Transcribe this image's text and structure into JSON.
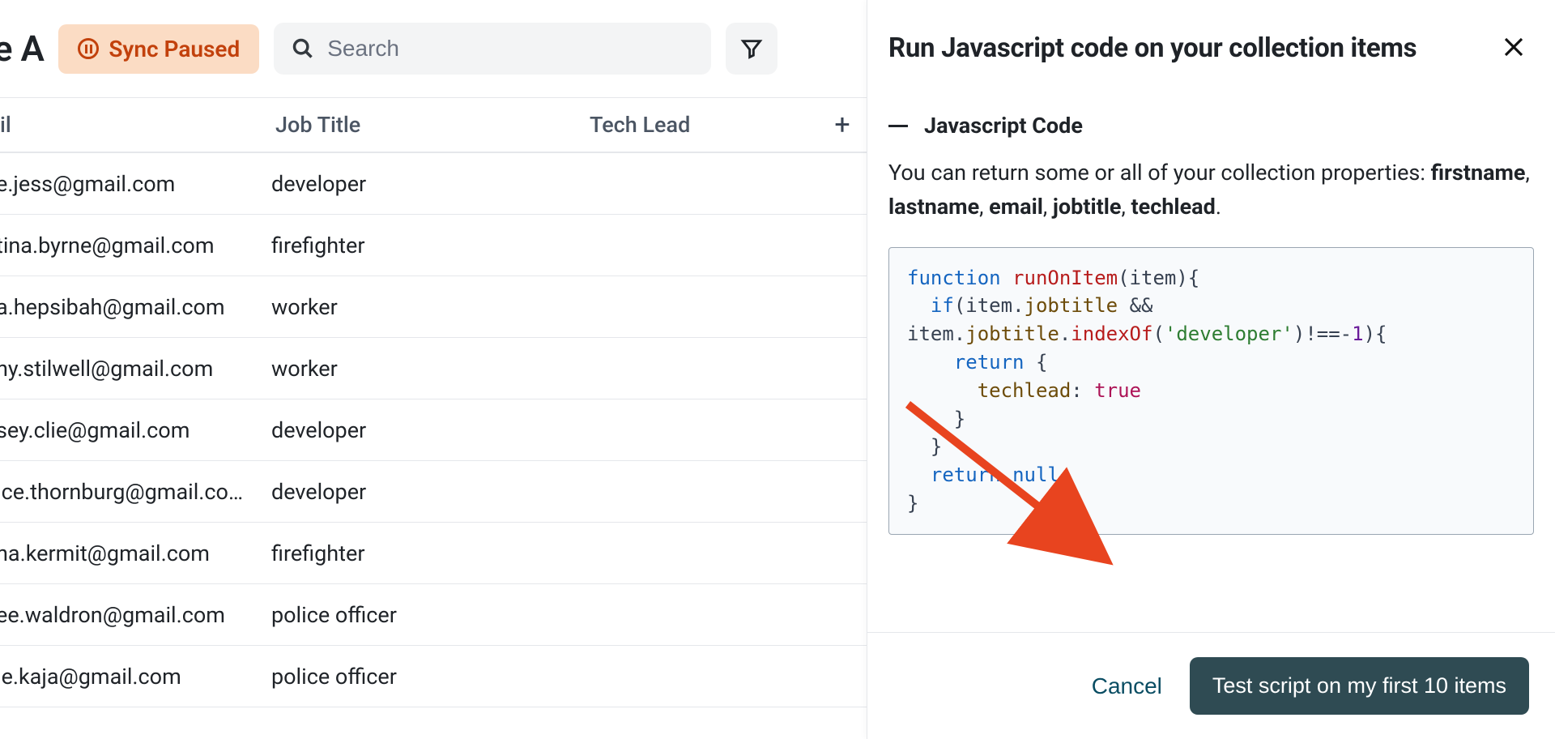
{
  "header": {
    "title_fragment": "ile A",
    "sync_status": "Sync Paused",
    "search_placeholder": "Search"
  },
  "table": {
    "columns": {
      "email": "il",
      "job": "Job Title",
      "tech": "Tech Lead"
    },
    "rows": [
      {
        "email": "e.jess@gmail.com",
        "job": "developer"
      },
      {
        "email": "tina.byrne@gmail.com",
        "job": "firefighter"
      },
      {
        "email": "a.hepsibah@gmail.com",
        "job": "worker"
      },
      {
        "email": "ny.stilwell@gmail.com",
        "job": "worker"
      },
      {
        "email": "sey.clie@gmail.com",
        "job": "developer"
      },
      {
        "email": "ice.thornburg@gmail.co…",
        "job": "developer"
      },
      {
        "email": "na.kermit@gmail.com",
        "job": "firefighter"
      },
      {
        "email": "ee.waldron@gmail.com",
        "job": "police officer"
      },
      {
        "email": "ie.kaja@gmail.com",
        "job": "police officer"
      }
    ]
  },
  "panel": {
    "title": "Run Javascript code on your collection items",
    "section_title": "Javascript Code",
    "desc_prefix": "You can return some or all of your collection properties: ",
    "properties": [
      "firstname",
      "lastname",
      "email",
      "jobtitle",
      "techlead"
    ],
    "code_tokens": [
      [
        [
          "kw",
          "function"
        ],
        [
          "sp",
          " "
        ],
        [
          "fn",
          "runOnItem"
        ],
        [
          "op",
          "("
        ],
        [
          "id",
          "item"
        ],
        [
          "op",
          ")"
        ],
        [
          "op",
          "{"
        ]
      ],
      [
        [
          "sp",
          "  "
        ],
        [
          "kw",
          "if"
        ],
        [
          "op",
          "("
        ],
        [
          "id",
          "item"
        ],
        [
          "op",
          "."
        ],
        [
          "prop",
          "jobtitle"
        ],
        [
          "sp",
          " "
        ],
        [
          "op",
          "&&"
        ]
      ],
      [
        [
          "id",
          "item"
        ],
        [
          "op",
          "."
        ],
        [
          "prop",
          "jobtitle"
        ],
        [
          "op",
          "."
        ],
        [
          "fn",
          "indexOf"
        ],
        [
          "op",
          "("
        ],
        [
          "str",
          "'developer'"
        ],
        [
          "op",
          ")"
        ],
        [
          "op",
          "!==-"
        ],
        [
          "num",
          "1"
        ],
        [
          "op",
          ")"
        ],
        [
          "op",
          "{"
        ]
      ],
      [
        [
          "sp",
          "    "
        ],
        [
          "kw",
          "return"
        ],
        [
          "sp",
          " "
        ],
        [
          "op",
          "{"
        ]
      ],
      [
        [
          "sp",
          "      "
        ],
        [
          "prop",
          "techlead"
        ],
        [
          "op",
          ":"
        ],
        [
          "sp",
          " "
        ],
        [
          "bool",
          "true"
        ]
      ],
      [
        [
          "sp",
          "    "
        ],
        [
          "op",
          "}"
        ]
      ],
      [
        [
          "sp",
          "  "
        ],
        [
          "op",
          "}"
        ]
      ],
      [
        [
          "sp",
          "  "
        ],
        [
          "kw",
          "return"
        ],
        [
          "sp",
          " "
        ],
        [
          "kw",
          "null"
        ],
        [
          "op",
          ";"
        ]
      ],
      [
        [
          "op",
          "}"
        ]
      ]
    ],
    "cancel_label": "Cancel",
    "test_label": "Test script on my first 10 items"
  }
}
